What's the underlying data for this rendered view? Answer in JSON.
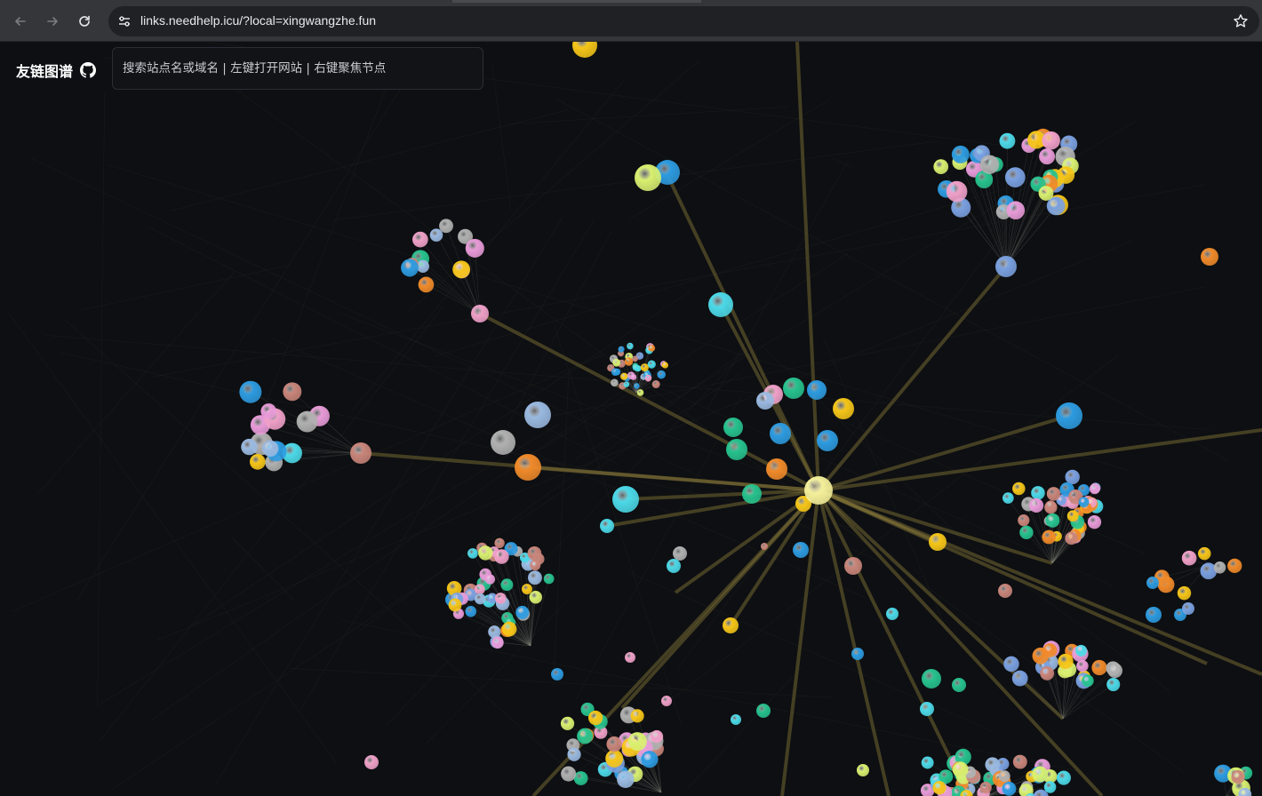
{
  "browser": {
    "url": "links.needhelp.icu/?local=xingwangzhe.fun",
    "back_icon": "arrow-left-icon",
    "forward_icon": "arrow-right-icon",
    "reload_icon": "reload-icon",
    "site_info_icon": "tune-icon",
    "bookmark_icon": "star-icon"
  },
  "header": {
    "title": "友链图谱",
    "github_icon": "github-icon"
  },
  "search": {
    "placeholder": "搜索站点名或域名 | 左键打开网站 | 右键聚焦节点",
    "value": ""
  },
  "colors": {
    "background": "#0d0f12",
    "edge": "#8a7a3a",
    "center_node": "#f3ef9a",
    "palette": [
      "#f5c518",
      "#2d9be0",
      "#e89bd8",
      "#27c28e",
      "#d8f070",
      "#9ab9e0",
      "#f08a2a",
      "#4cd9e8",
      "#b0b0b0",
      "#c9857a",
      "#f0a0c8",
      "#7aa0e0"
    ]
  }
}
